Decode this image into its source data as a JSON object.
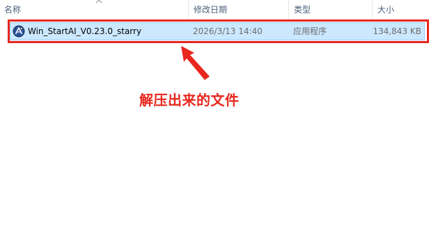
{
  "columns": {
    "name": "名称",
    "date_modified": "修改日期",
    "type": "类型",
    "size": "大小"
  },
  "sort": {
    "column": "name",
    "direction": "ascending",
    "indicator_icon": "chevron-up-icon"
  },
  "files": [
    {
      "name": "Win_StartAI_V0.23.0_starry",
      "date_modified": "2026/3/13 14:40",
      "type": "应用程序",
      "size": "134,843 KB",
      "icon": "starry-app-icon",
      "selected": true
    }
  ],
  "annotation": {
    "text": "解压出来的文件",
    "color": "#e8261d"
  },
  "colors": {
    "selection_fill": "#cce8ff",
    "selection_border": "#99d1ff",
    "header_text": "#4c607a",
    "secondary_text": "#6d6d6d"
  }
}
